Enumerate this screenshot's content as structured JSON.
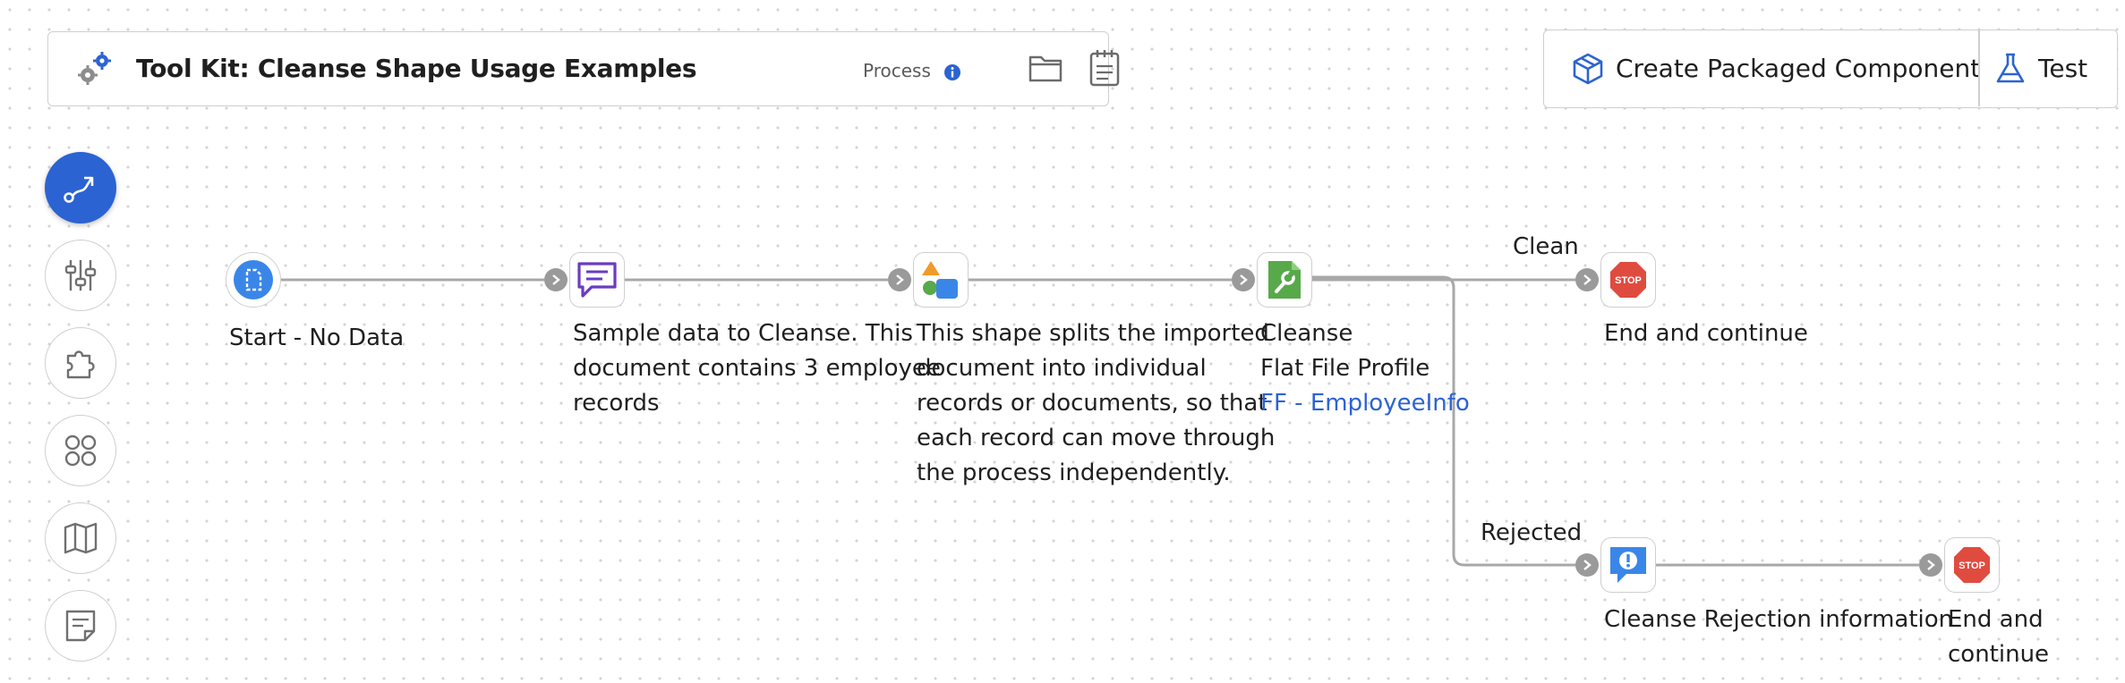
{
  "header": {
    "title": "Tool Kit: Cleanse Shape Usage Examples",
    "type_label": "Process"
  },
  "actions": {
    "create_packaged_component": "Create Packaged Component",
    "test": "Test"
  },
  "sidebar": {
    "items": [
      {
        "icon": "process-flow-icon",
        "active": true
      },
      {
        "icon": "sliders-icon",
        "active": false
      },
      {
        "icon": "puzzle-icon",
        "active": false
      },
      {
        "icon": "components-grid-icon",
        "active": false
      },
      {
        "icon": "map-icon",
        "active": false
      },
      {
        "icon": "notes-icon",
        "active": false
      }
    ]
  },
  "canvas": {
    "shapes": {
      "start": {
        "lines": [
          "Start - No Data"
        ]
      },
      "message": {
        "lines": [
          "Sample data to Cleanse. This",
          "document contains 3 employee",
          "records"
        ]
      },
      "split": {
        "lines": [
          "This shape splits the imported",
          "document into individual",
          "records or documents, so that",
          "each record can move through",
          "the process independently."
        ]
      },
      "cleanse": {
        "lines": [
          "Cleanse",
          "Flat File Profile"
        ],
        "link": "FF - EmployeeInfo"
      },
      "stop_clean": {
        "lines": [
          "End and continue"
        ]
      },
      "exception": {
        "lines": [
          "Cleanse Rejection information"
        ]
      },
      "stop_rejected": {
        "lines": [
          "End and",
          "continue"
        ]
      }
    },
    "branch_labels": {
      "clean": "Clean",
      "rejected": "Rejected"
    },
    "stop_sign_text": "STOP",
    "colors": {
      "accent": "#2c63d2",
      "connector": "#9a9a9a",
      "cleanse_green": "#58a94a",
      "stop_red": "#e04b3f",
      "message_purple": "#6a3cc0"
    }
  }
}
